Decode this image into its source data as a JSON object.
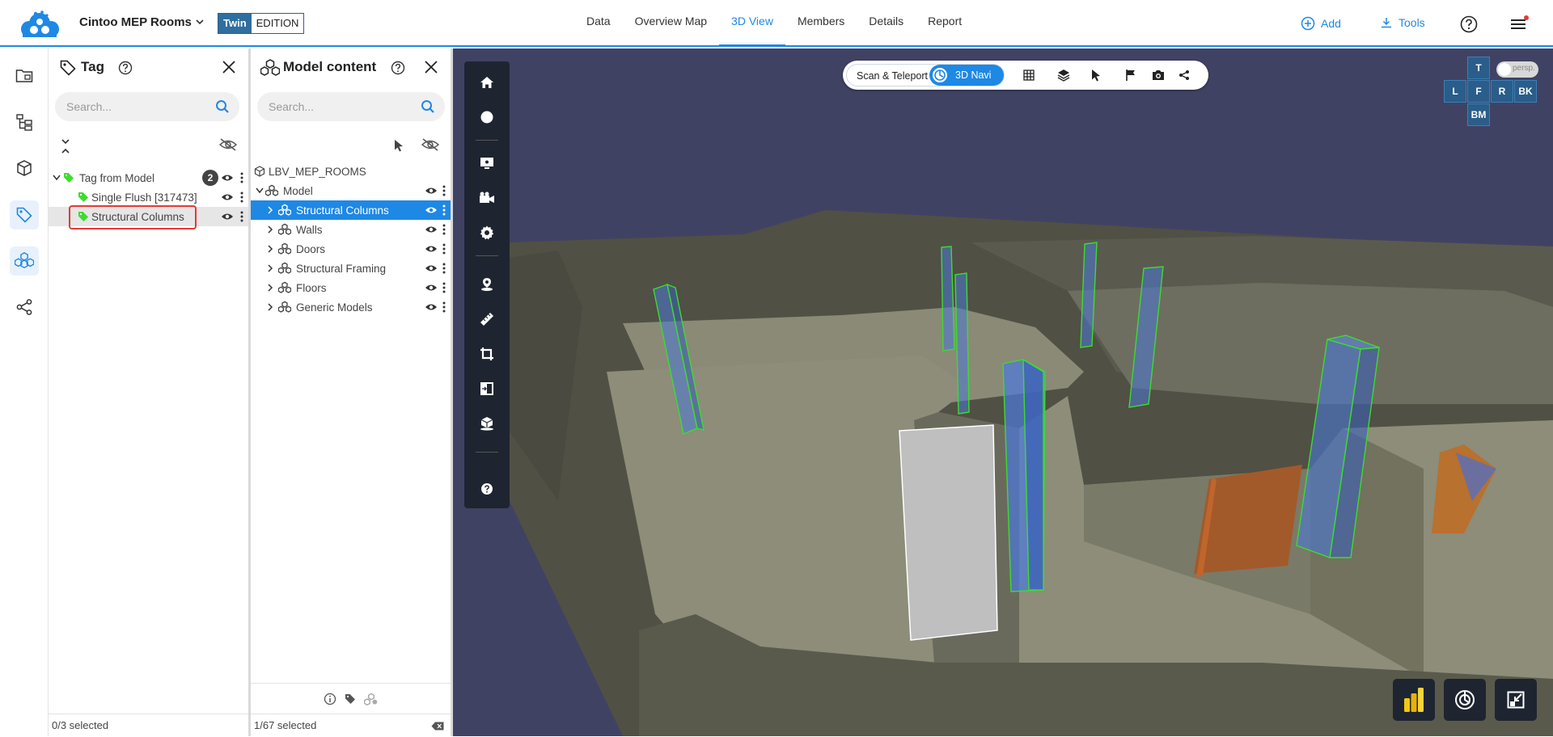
{
  "header": {
    "project_title": "Cintoo MEP Rooms",
    "edition_twin": "Twin",
    "edition_label": "EDITION",
    "nav": [
      {
        "label": "Data"
      },
      {
        "label": "Overview Map"
      },
      {
        "label": "3D View",
        "active": true
      },
      {
        "label": "Members"
      },
      {
        "label": "Details"
      },
      {
        "label": "Report"
      }
    ],
    "add_label": "Add",
    "tools_label": "Tools",
    "accent_color": "#1e88e5"
  },
  "rail": {
    "items": [
      "data-folder-icon",
      "tree-icon",
      "cube-icon",
      "tag-icon",
      "model-content-icon",
      "share-icon"
    ],
    "active": "tag-icon"
  },
  "tag_panel": {
    "title": "Tag",
    "search_placeholder": "Search...",
    "tree": {
      "root_label": "Tag from Model",
      "root_count": "2",
      "children": [
        "Single Flush [317473]",
        "Structural Columns"
      ]
    },
    "footer": "0/3 selected"
  },
  "model_panel": {
    "title": "Model content",
    "search_placeholder": "Search...",
    "root_label": "LBV_MEP_ROOMS",
    "model_label": "Model",
    "categories": [
      {
        "label": "Structural Columns",
        "selected": true
      },
      {
        "label": "Walls"
      },
      {
        "label": "Doors"
      },
      {
        "label": "Structural Framing"
      },
      {
        "label": "Floors"
      },
      {
        "label": "Generic Models"
      }
    ],
    "footer": "1/67 selected"
  },
  "viewport": {
    "mode_scan": "Scan & Teleport",
    "mode_navi": "3D Navi",
    "viewcube": [
      "T",
      "L",
      "F",
      "R",
      "BK",
      "BM"
    ],
    "persp_label": "persp.",
    "background_color": "#404264",
    "highlight_color": "#3ddc2f"
  }
}
